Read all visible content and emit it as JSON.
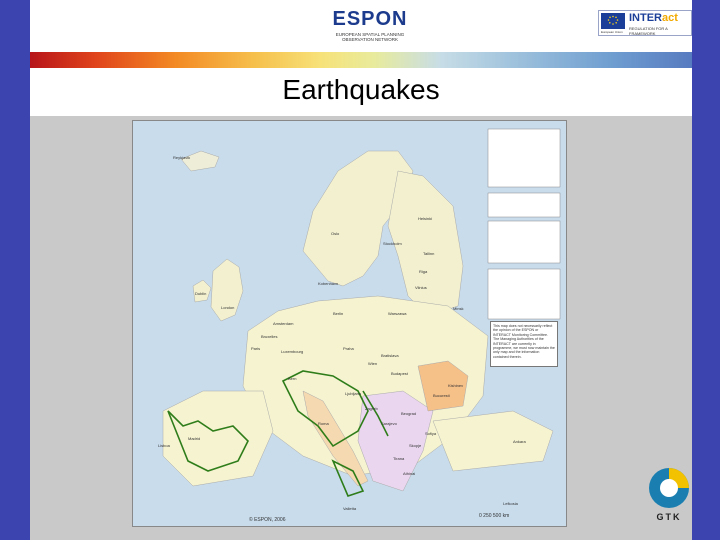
{
  "header": {
    "espon_word": "ESPON",
    "espon_sub": "EUROPEAN SPATIAL PLANNING OBSERVATION NETWORK",
    "interact_name_1": "INTER",
    "interact_name_2": "act",
    "interact_sub": "REGULATION FOR A FRAMEWORK",
    "eu_sub": "European Union"
  },
  "slide": {
    "title": "Earthquakes"
  },
  "map": {
    "disclaimer": "This map does not necessarily reflect the opinion of the ESPON or INTERACT Monitoring Committee. The Managing Authorities of the INTERACT are currently in programme, we must now maintain the only map and the information contained therein.",
    "copyright": "© ESPON, 2006",
    "scale": "0      250      500 km",
    "labels": [
      "Reykjavik",
      "Dublin",
      "London",
      "Paris",
      "Madrid",
      "Lisboa",
      "Roma",
      "Berlin",
      "Oslo",
      "Stockholm",
      "Helsinki",
      "Tallinn",
      "Riga",
      "Vilnius",
      "Minsk",
      "Warszawa",
      "Praha",
      "Wien",
      "Bratislava",
      "Budapest",
      "Zagreb",
      "Sarajevo",
      "Beograd",
      "Sofiya",
      "Bucuresti",
      "Ankara",
      "Athinai",
      "Kishinev",
      "Kobenhavn",
      "Amsterdam",
      "Bruxelles",
      "Luxembourg",
      "Bern",
      "Ljubljana",
      "Tirana",
      "Skopje",
      "Valletta",
      "Lefkosia"
    ]
  },
  "branding": {
    "gtk": "GTK"
  },
  "colors": {
    "slide_border": "#3c44b0",
    "slide_bg": "#c9c9c9",
    "fault_green": "#2f7d1a"
  }
}
